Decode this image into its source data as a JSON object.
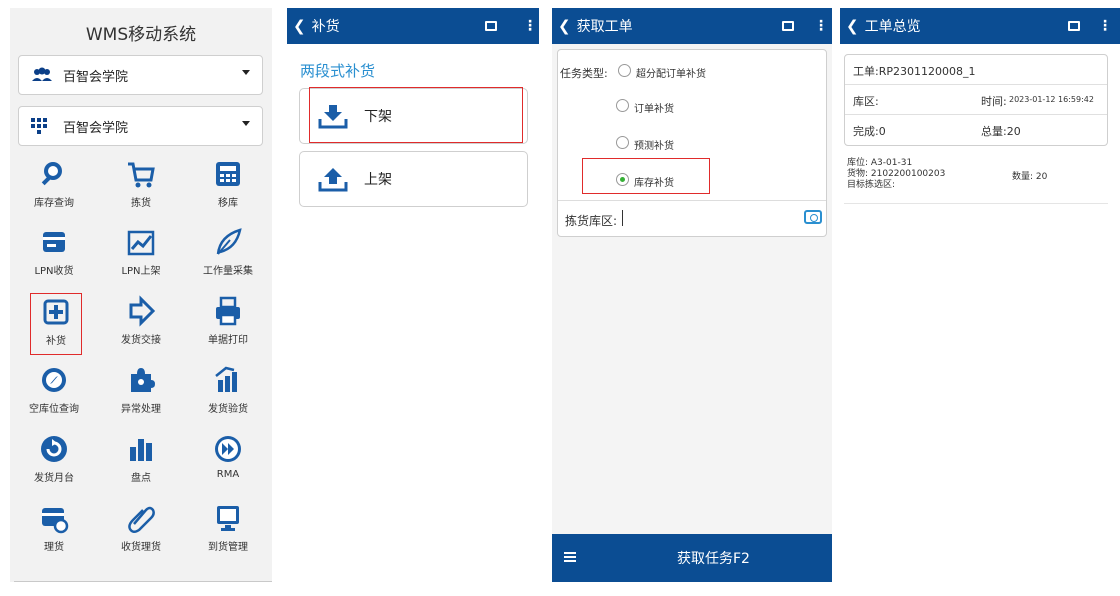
{
  "screen1": {
    "title": "WMS移动系统",
    "dropdowns": [
      {
        "label": "百智会学院",
        "icon": "group-icon"
      },
      {
        "label": "百智会学院",
        "icon": "grid-icon"
      }
    ],
    "menu": [
      {
        "label": "库存查询",
        "icon": "search-icon"
      },
      {
        "label": "拣货",
        "icon": "cart-icon"
      },
      {
        "label": "移库",
        "icon": "calculator-icon"
      },
      {
        "label": "LPN收货",
        "icon": "card-icon"
      },
      {
        "label": "LPN上架",
        "icon": "chart-up-icon"
      },
      {
        "label": "工作量采集",
        "icon": "feather-icon"
      },
      {
        "label": "补货",
        "icon": "plus-box-icon"
      },
      {
        "label": "发货交接",
        "icon": "arrow-right-icon"
      },
      {
        "label": "单据打印",
        "icon": "printer-icon"
      },
      {
        "label": "空库位查询",
        "icon": "compass-icon"
      },
      {
        "label": "异常处理",
        "icon": "puzzle-icon"
      },
      {
        "label": "发货验货",
        "icon": "growth-bars-icon"
      },
      {
        "label": "发货月台",
        "icon": "refresh-icon"
      },
      {
        "label": "盘点",
        "icon": "bars-icon"
      },
      {
        "label": "RMA",
        "icon": "fast-forward-icon"
      },
      {
        "label": "理货",
        "icon": "tally-icon"
      },
      {
        "label": "收货理货",
        "icon": "paperclip-icon"
      },
      {
        "label": "到货管理",
        "icon": "monitor-icon"
      }
    ]
  },
  "screen2": {
    "header": "补货",
    "subtitle": "两段式补货",
    "cards": [
      {
        "label": "下架",
        "icon": "tray-download-icon"
      },
      {
        "label": "上架",
        "icon": "tray-upload-icon"
      }
    ]
  },
  "screen3": {
    "header": "获取工单",
    "task_type_label": "任务类型:",
    "options": [
      {
        "label": "超分配订单补货",
        "selected": false
      },
      {
        "label": "订单补货",
        "selected": false
      },
      {
        "label": "预测补货",
        "selected": false
      },
      {
        "label": "库存补货",
        "selected": true
      }
    ],
    "pick_area_label": "拣货库区:",
    "footer_button": "获取任务F2"
  },
  "screen4": {
    "header": "工单总览",
    "order": "工单:RP2301120008_1",
    "area_label": "库区:",
    "time_label": "时间:",
    "time_value": "2023-01-12 16:59:42",
    "done_label": "完成:0",
    "total_label": "总量:20",
    "location": "库位: A3-01-31",
    "goods": "货物: 2102200100203",
    "qty": "数量: 20",
    "target_area": "目标拣选区:"
  },
  "colors": {
    "header_blue": "#0b4d93",
    "accent_blue": "#2a8fd0",
    "highlight_red": "#e02b2b",
    "radio_green": "#36b036"
  }
}
